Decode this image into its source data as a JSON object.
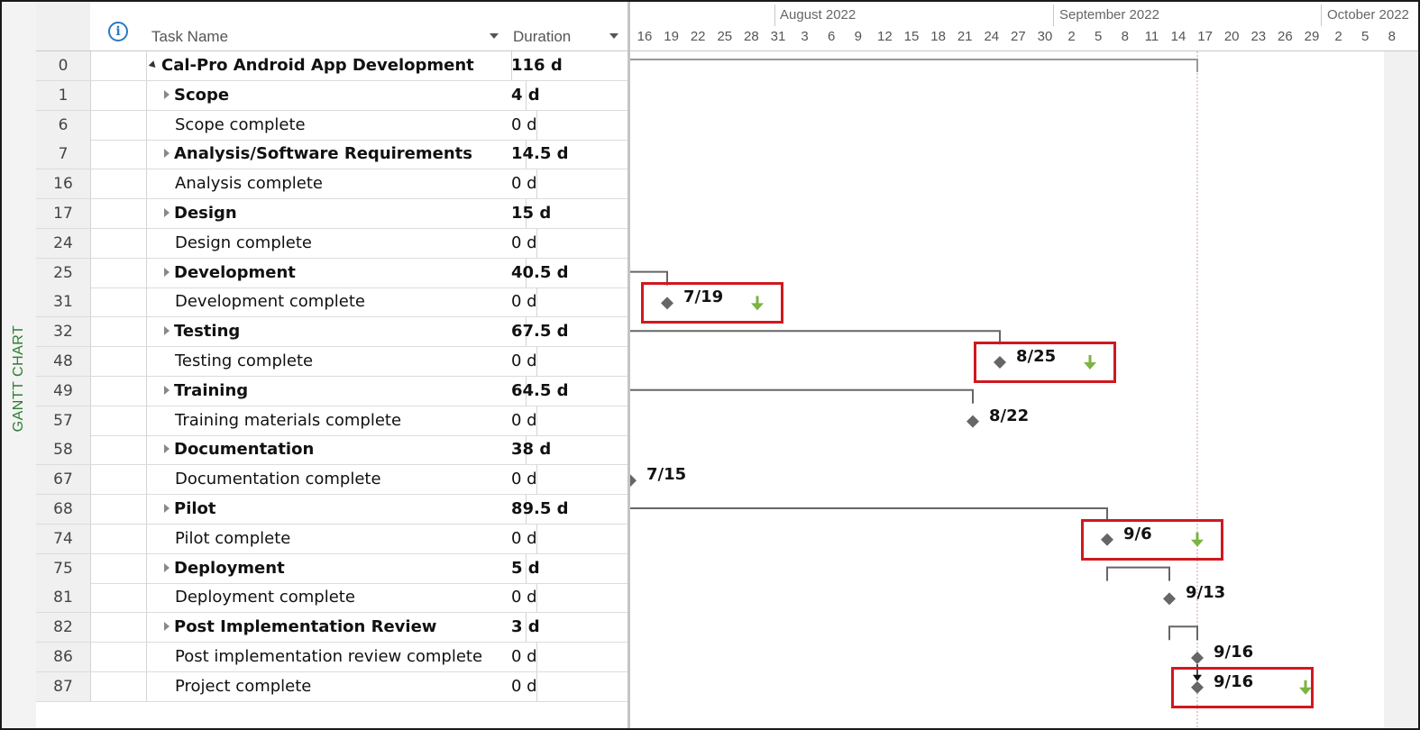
{
  "view_label": "GANTT CHART",
  "columns": {
    "task_name": "Task Name",
    "duration": "Duration",
    "info_glyph": "i"
  },
  "tasks": [
    {
      "id": "0",
      "name": "Cal-Pro Android App Development",
      "duration": "116 d",
      "summary": true,
      "expanded": true,
      "indent": 0
    },
    {
      "id": "1",
      "name": "Scope",
      "duration": "4 d",
      "summary": true,
      "indent": 1
    },
    {
      "id": "6",
      "name": "Scope complete",
      "duration": "0 d",
      "summary": false,
      "indent": 1
    },
    {
      "id": "7",
      "name": "Analysis/Software Requirements",
      "duration": "14.5 d",
      "summary": true,
      "indent": 1
    },
    {
      "id": "16",
      "name": "Analysis complete",
      "duration": "0 d",
      "summary": false,
      "indent": 1
    },
    {
      "id": "17",
      "name": "Design",
      "duration": "15 d",
      "summary": true,
      "indent": 1
    },
    {
      "id": "24",
      "name": "Design complete",
      "duration": "0 d",
      "summary": false,
      "indent": 1
    },
    {
      "id": "25",
      "name": "Development",
      "duration": "40.5 d",
      "summary": true,
      "indent": 1
    },
    {
      "id": "31",
      "name": "Development complete",
      "duration": "0 d",
      "summary": false,
      "indent": 1
    },
    {
      "id": "32",
      "name": "Testing",
      "duration": "67.5 d",
      "summary": true,
      "indent": 1
    },
    {
      "id": "48",
      "name": "Testing complete",
      "duration": "0 d",
      "summary": false,
      "indent": 1
    },
    {
      "id": "49",
      "name": "Training",
      "duration": "64.5 d",
      "summary": true,
      "indent": 1
    },
    {
      "id": "57",
      "name": "Training materials complete",
      "duration": "0 d",
      "summary": false,
      "indent": 1
    },
    {
      "id": "58",
      "name": "Documentation",
      "duration": "38 d",
      "summary": true,
      "indent": 1
    },
    {
      "id": "67",
      "name": "Documentation complete",
      "duration": "0 d",
      "summary": false,
      "indent": 1
    },
    {
      "id": "68",
      "name": "Pilot",
      "duration": "89.5 d",
      "summary": true,
      "indent": 1
    },
    {
      "id": "74",
      "name": "Pilot complete",
      "duration": "0 d",
      "summary": false,
      "indent": 1
    },
    {
      "id": "75",
      "name": "Deployment",
      "duration": "5 d",
      "summary": true,
      "indent": 1
    },
    {
      "id": "81",
      "name": "Deployment complete",
      "duration": "0 d",
      "summary": false,
      "indent": 1
    },
    {
      "id": "82",
      "name": "Post Implementation Review",
      "duration": "3 d",
      "summary": true,
      "indent": 1
    },
    {
      "id": "86",
      "name": "Post implementation review complete",
      "duration": "0 d",
      "summary": false,
      "indent": 1
    },
    {
      "id": "87",
      "name": "Project complete",
      "duration": "0 d",
      "summary": false,
      "indent": 1
    }
  ],
  "timeline": {
    "months": [
      "August 2022",
      "September 2022",
      "October 2022"
    ],
    "days": [
      "16",
      "19",
      "22",
      "25",
      "28",
      "31",
      "3",
      "6",
      "9",
      "12",
      "15",
      "18",
      "21",
      "24",
      "27",
      "30",
      "2",
      "5",
      "8",
      "11",
      "14",
      "17",
      "20",
      "23",
      "26",
      "29",
      "2",
      "5",
      "8"
    ],
    "status_date": "9/16"
  },
  "milestones": [
    {
      "task_id": "31",
      "date": "7/19",
      "highlighted": true,
      "arrow": true
    },
    {
      "task_id": "48",
      "date": "8/25",
      "highlighted": true,
      "arrow": true
    },
    {
      "task_id": "57",
      "date": "8/22",
      "highlighted": false,
      "arrow": false
    },
    {
      "task_id": "67",
      "date": "7/15",
      "highlighted": false,
      "arrow": false
    },
    {
      "task_id": "74",
      "date": "9/6",
      "highlighted": true,
      "arrow": true
    },
    {
      "task_id": "81",
      "date": "9/13",
      "highlighted": false,
      "arrow": false
    },
    {
      "task_id": "86",
      "date": "9/16",
      "highlighted": false,
      "arrow": false
    },
    {
      "task_id": "87",
      "date": "9/16",
      "highlighted": true,
      "arrow": true
    }
  ],
  "colors": {
    "highlight": "#d0181f",
    "milestone": "#666666",
    "arrow": "#7cb342",
    "summary_bar": "#666666",
    "view_label": "#2e7d32",
    "info_icon": "#2b79c2"
  }
}
